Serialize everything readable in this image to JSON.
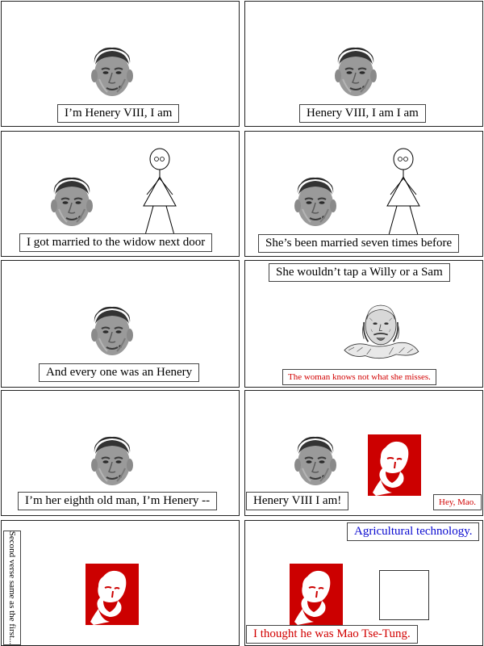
{
  "panels": [
    {
      "captions": [
        "I’m Henery VIII, I am"
      ]
    },
    {
      "captions": [
        "Henery VIII, I am I am"
      ]
    },
    {
      "captions": [
        "I got married to the widow next door"
      ]
    },
    {
      "captions": [
        "She’s been married seven times before"
      ]
    },
    {
      "captions": [
        "And every one was an Henery"
      ]
    },
    {
      "captions": [
        "She wouldn’t tap a Willy or a Sam",
        "The woman knows not what she misses."
      ]
    },
    {
      "captions": [
        "I’m her eighth old man, I’m Henery --"
      ]
    },
    {
      "captions": [
        "Henery VIII I am!",
        "Hey, Mao."
      ]
    },
    {
      "captions": [
        "Second verse same as the first..."
      ]
    },
    {
      "captions": [
        "Agricultural technology.",
        "I thought he was Mao Tse-Tung."
      ]
    }
  ],
  "colors": {
    "red_text": "#d20000",
    "blue_text": "#0a0ad0",
    "poster_red": "#cc0000",
    "border": "#222222"
  },
  "icons": [
    "mao-face-icon",
    "shakespeare-bust-icon",
    "lenin-poster-icon",
    "stick-figure-icon"
  ]
}
